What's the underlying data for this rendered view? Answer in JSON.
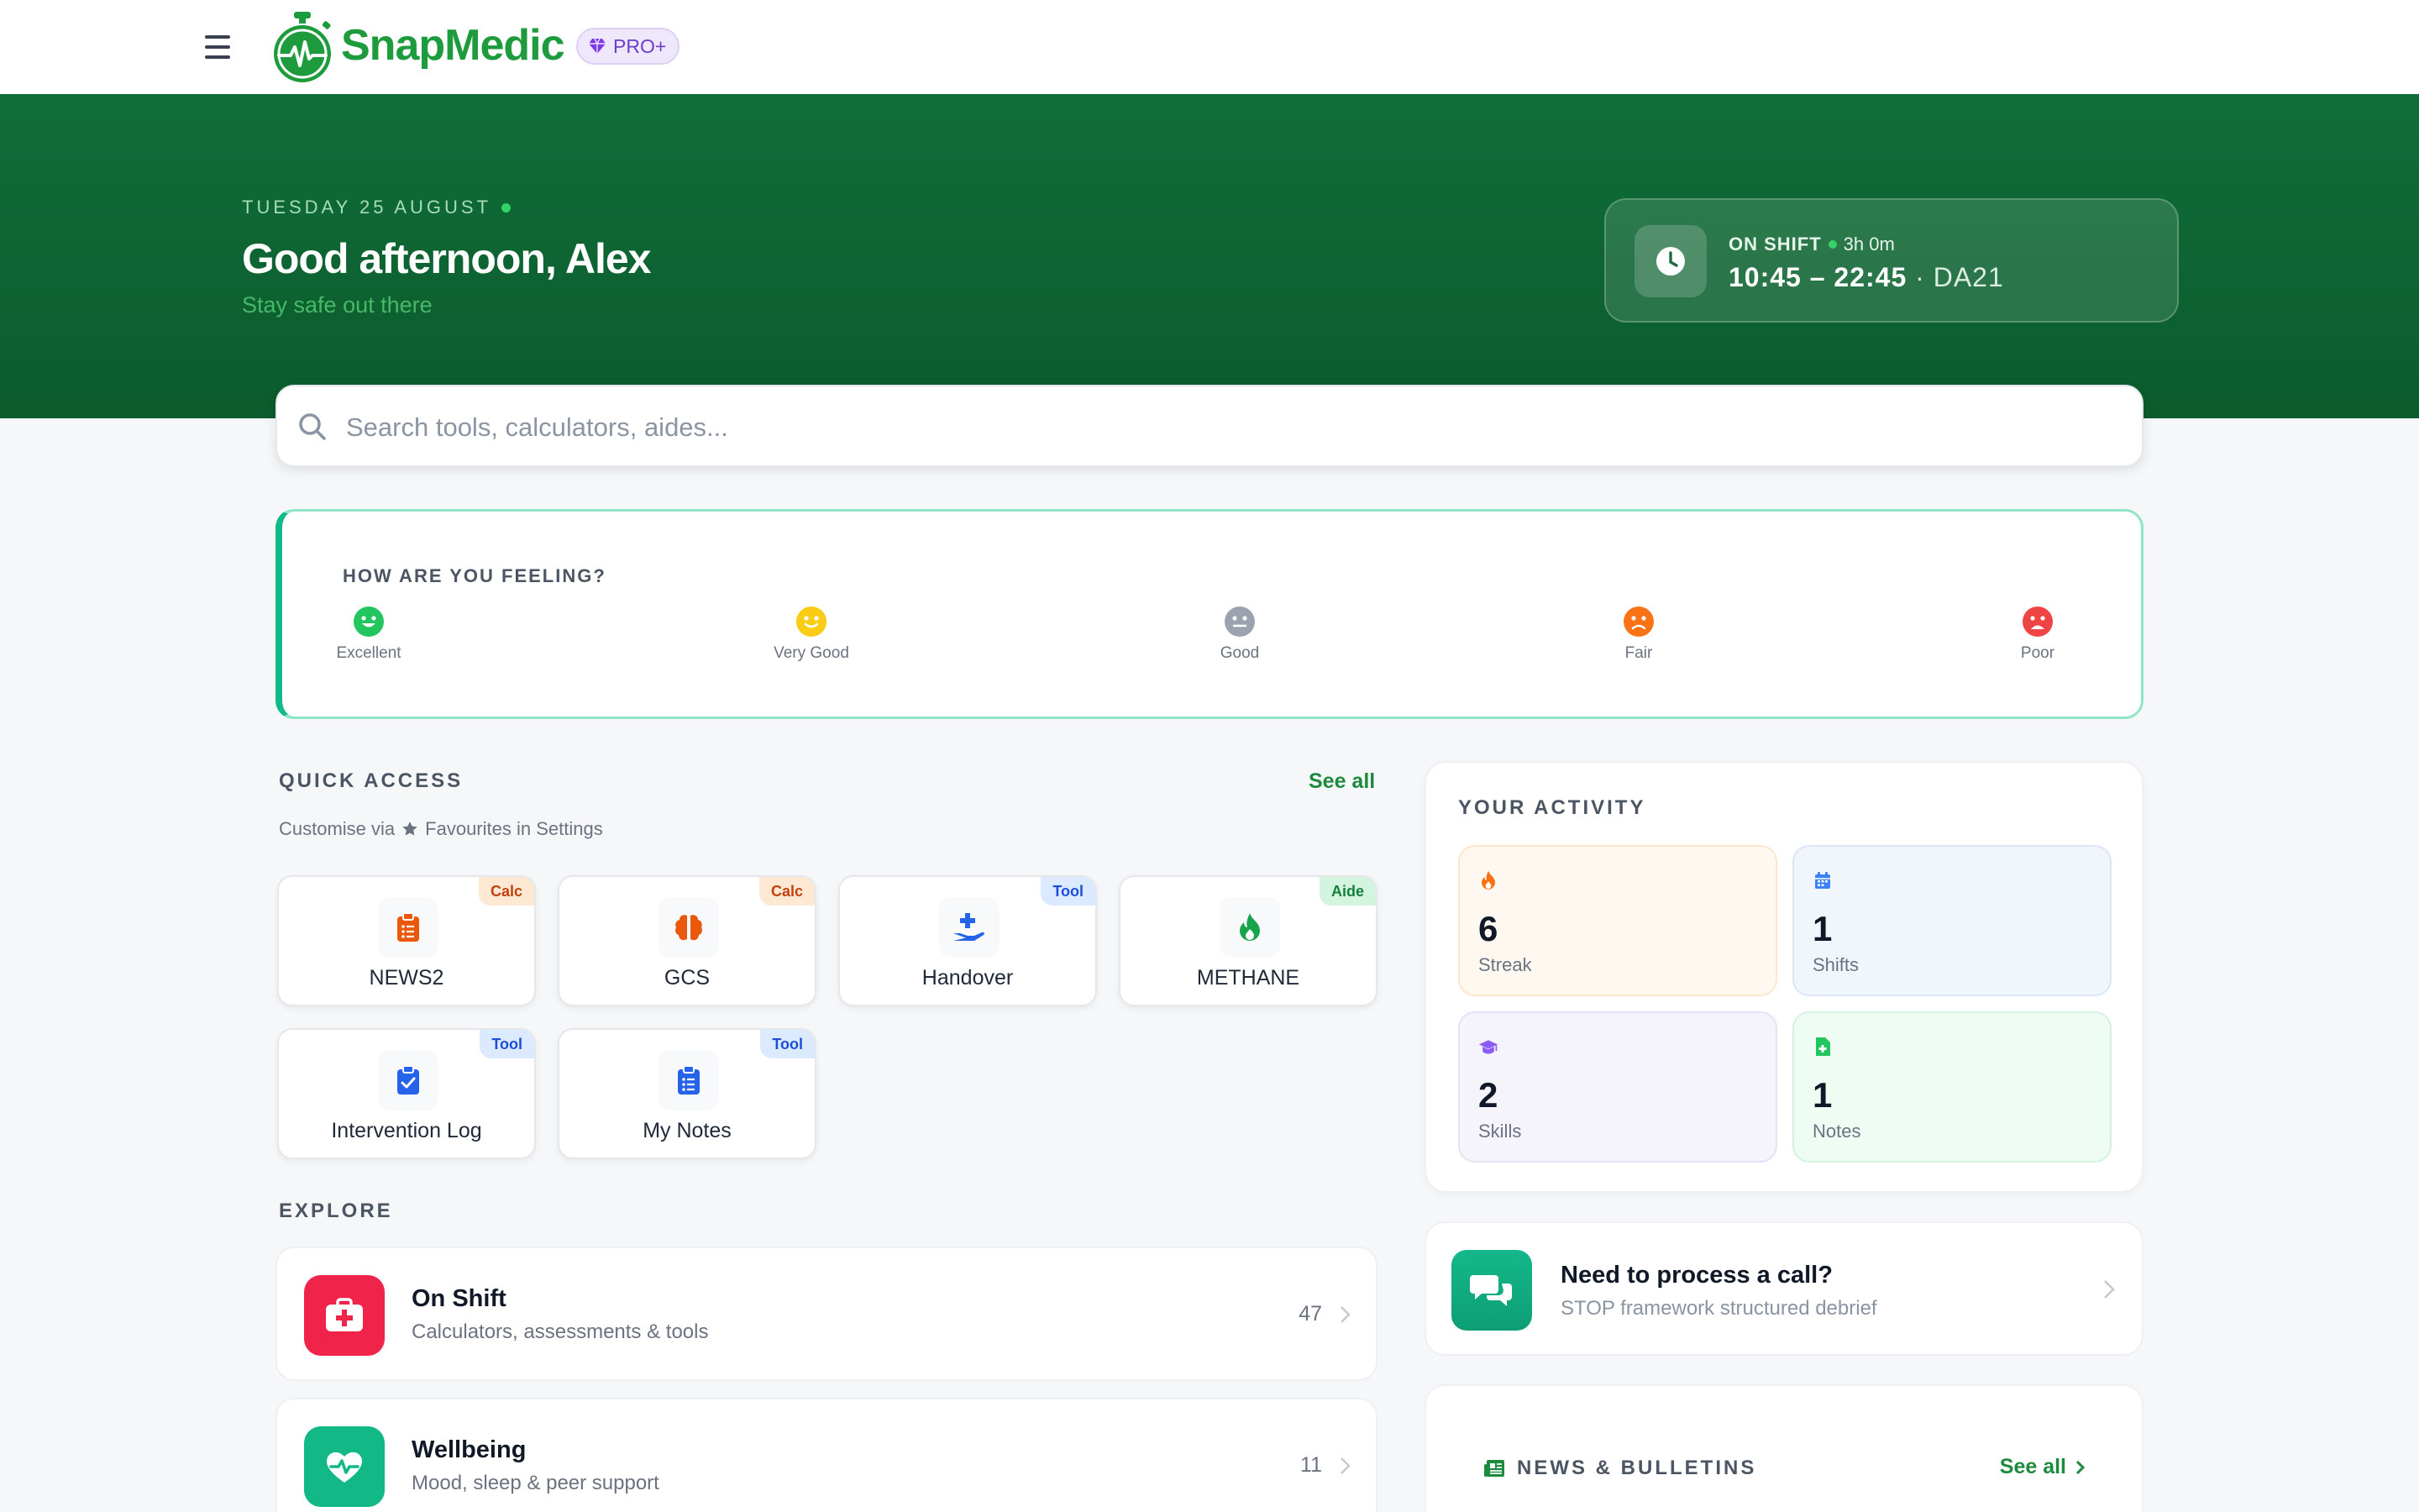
{
  "app": {
    "brand": "SnapMedic",
    "plan_badge": "PRO+"
  },
  "hero": {
    "date": "TUESDAY 25 AUGUST",
    "greeting": "Good afternoon, Alex",
    "subtitle": "Stay safe out there",
    "shift": {
      "status": "ON SHIFT",
      "duration": "3h 0m",
      "time": "10:45 – 22:45",
      "unit": "· DA21"
    }
  },
  "search": {
    "placeholder": "Search tools, calculators, aides..."
  },
  "feeling": {
    "title": "HOW ARE YOU FEELING?",
    "options": [
      {
        "label": "Excellent",
        "color": "#22c55e"
      },
      {
        "label": "Very Good",
        "color": "#facc15"
      },
      {
        "label": "Good",
        "color": "#9ca3af"
      },
      {
        "label": "Fair",
        "color": "#f97316"
      },
      {
        "label": "Poor",
        "color": "#ef4444"
      }
    ]
  },
  "quick_access": {
    "title": "QUICK ACCESS",
    "see_all": "See all",
    "subtitle_prefix": "Customise via",
    "subtitle_suffix": "Favourites in Settings",
    "tiles": [
      {
        "name": "NEWS2",
        "tag": "Calc",
        "icon": "clipboard-list-icon",
        "color": "#ea580c"
      },
      {
        "name": "GCS",
        "tag": "Calc",
        "icon": "brain-icon",
        "color": "#ea580c"
      },
      {
        "name": "Handover",
        "tag": "Tool",
        "icon": "hand-holding-medical-icon",
        "color": "#2563eb"
      },
      {
        "name": "METHANE",
        "tag": "Aide",
        "icon": "fire-icon",
        "color": "#16a34a"
      },
      {
        "name": "Intervention Log",
        "tag": "Tool",
        "icon": "clipboard-check-icon",
        "color": "#2563eb"
      },
      {
        "name": "My Notes",
        "tag": "Tool",
        "icon": "clipboard-list-icon",
        "color": "#2563eb"
      }
    ]
  },
  "explore": {
    "title": "EXPLORE",
    "items": [
      {
        "title": "On Shift",
        "desc": "Calculators, assessments & tools",
        "count": "47",
        "icon": "first-aid-kit-icon",
        "color": "#f0244a"
      },
      {
        "title": "Wellbeing",
        "desc": "Mood, sleep & peer support",
        "count": "11",
        "icon": "heart-pulse-icon",
        "color": "#12b886"
      }
    ]
  },
  "activity": {
    "title": "YOUR ACTIVITY",
    "stats": [
      {
        "value": "6",
        "label": "Streak",
        "icon": "fire-icon",
        "accent": "#f97316",
        "bg": "#fff8f0",
        "border": "#fde6cc"
      },
      {
        "value": "1",
        "label": "Shifts",
        "icon": "calendar-icon",
        "accent": "#3b82f6",
        "bg": "#f1f6fd",
        "border": "#dbe7f8"
      },
      {
        "value": "2",
        "label": "Skills",
        "icon": "graduation-cap-icon",
        "accent": "#8b5cf6",
        "bg": "#f5f4fb",
        "border": "#e5e1f6"
      },
      {
        "value": "1",
        "label": "Notes",
        "icon": "file-medical-icon",
        "accent": "#22c55e",
        "bg": "#effcf4",
        "border": "#d3f2e0"
      }
    ]
  },
  "call": {
    "title": "Need to process a call?",
    "desc": "STOP framework structured debrief"
  },
  "news": {
    "title": "NEWS & BULLETINS",
    "see_all": "See all"
  }
}
